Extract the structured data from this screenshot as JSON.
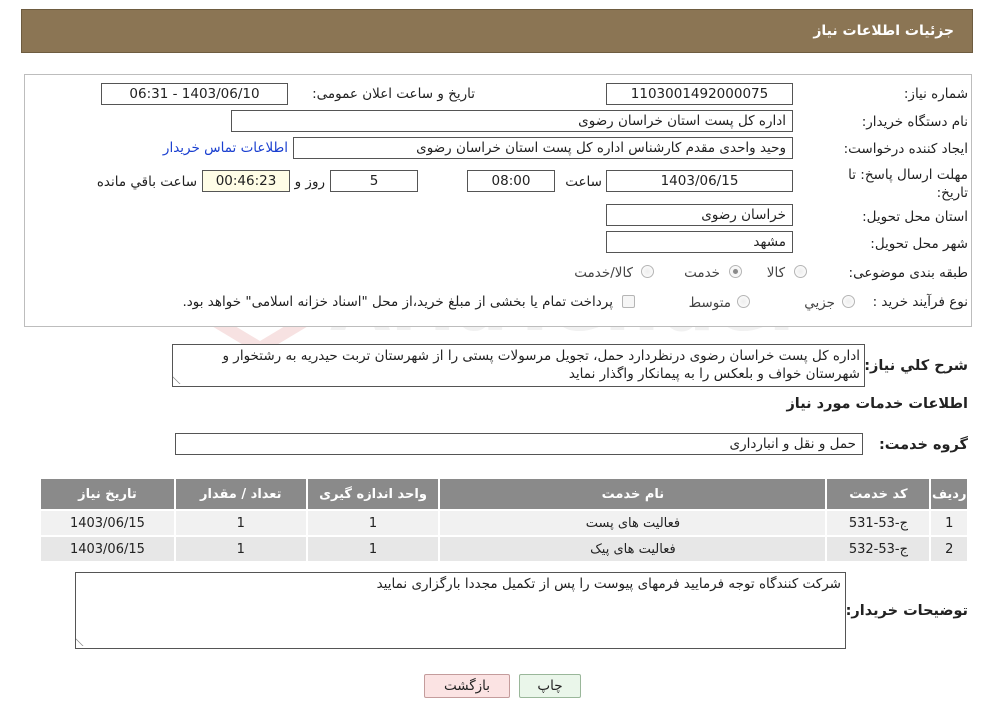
{
  "header": {
    "title": "جزئیات اطلاعات نیاز"
  },
  "form": {
    "need_number_label": "شماره نیاز:",
    "need_number": "1103001492000075",
    "announce_datetime_label": "تاریخ و ساعت اعلان عمومی:",
    "announce_datetime": "1403/06/10 - 06:31",
    "buyer_org_label": "نام دستگاه خریدار:",
    "buyer_org": "اداره کل پست استان خراسان رضوی",
    "requester_label": "ایجاد کننده درخواست:",
    "requester": "وحید واحدی مقدم کارشناس اداره کل پست استان خراسان رضوی",
    "contact_link": "اطلاعات تماس خریدار",
    "deadline_label": "مهلت ارسال پاسخ: تا تاریخ:",
    "deadline_date": "1403/06/15",
    "time_label": "ساعت",
    "deadline_time": "08:00",
    "days_value": "5",
    "days_label": "روز و",
    "remaining_time": "00:46:23",
    "remaining_label": "ساعت باقي مانده",
    "delivery_province_label": "استان محل تحویل:",
    "delivery_province": "خراسان رضوی",
    "delivery_city_label": "شهر محل تحویل:",
    "delivery_city": "مشهد",
    "category_label": "طبقه بندی موضوعی:",
    "category_options": [
      "کالا",
      "خدمت",
      "کالا/خدمت"
    ],
    "category_selected": "خدمت",
    "purchase_type_label": "نوع فرآیند خرید :",
    "purchase_type_options": [
      "جزيي",
      "متوسط"
    ],
    "payment_note": "پرداخت تمام یا بخشی از مبلغ خرید،از محل \"اسناد خزانه اسلامی\" خواهد بود."
  },
  "description": {
    "label": "شرح کلي نياز:",
    "text": "اداره کل پست خراسان رضوی درنظردارد حمل، تجویل مرسولات پستی را از شهرستان تربت حیدریه به رشتخوار و شهرستان خواف و بلعکس را به پیمانکار واگذار نماید"
  },
  "services_section": {
    "title": "اطلاعات خدمات مورد نیاز",
    "group_label": "گروه خدمت:",
    "group_value": "حمل و نقل و انبارداری"
  },
  "table": {
    "headers": [
      "ردیف",
      "کد خدمت",
      "نام خدمت",
      "واحد اندازه گیری",
      "تعداد / مقدار",
      "تاریخ نیاز"
    ],
    "rows": [
      [
        "1",
        "ج-53-531",
        "فعالیت های پست",
        "1",
        "1",
        "1403/06/15"
      ],
      [
        "2",
        "ج-53-532",
        "فعالیت های پیک",
        "1",
        "1",
        "1403/06/15"
      ]
    ]
  },
  "buyer_notes": {
    "label": "توضیحات خریدار:",
    "text": "شرکت کنندگاه توجه فرمایید فرمهای پیوست را پس از تکمیل مجددا بارگزاری نمایید"
  },
  "buttons": {
    "print": "چاپ",
    "back": "بازگشت"
  },
  "watermark": {
    "text": "AriaTender.neT"
  }
}
